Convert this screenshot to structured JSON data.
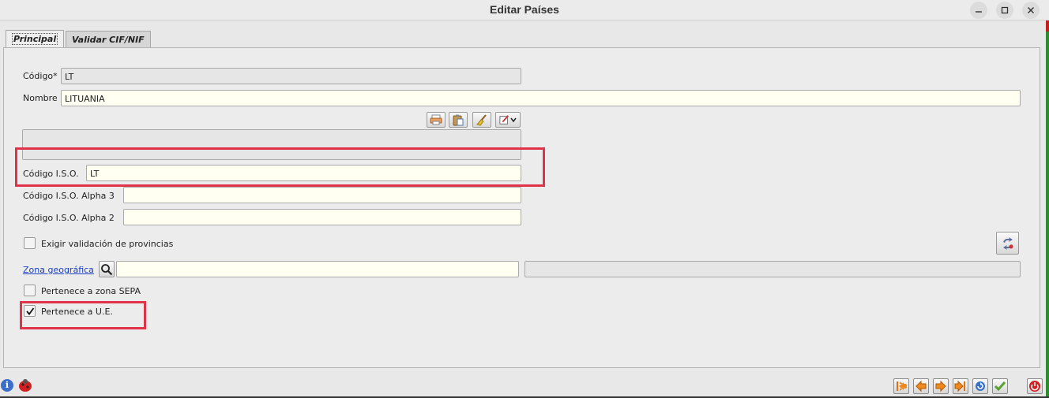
{
  "window": {
    "title": "Editar Países"
  },
  "tabs": [
    {
      "label": "Principal",
      "active": true
    },
    {
      "label": "Validar CIF/NIF",
      "active": false
    }
  ],
  "form": {
    "codigo": {
      "label": "Código*",
      "value": "LT"
    },
    "nombre": {
      "label": "Nombre",
      "value": "LITUANIA"
    },
    "codigo_iso": {
      "label": "Código I.S.O.",
      "value": "LT"
    },
    "codigo_iso_alpha3": {
      "label": "Código I.S.O. Alpha 3",
      "value": ""
    },
    "codigo_iso_alpha2": {
      "label": "Código I.S.O. Alpha 2",
      "value": ""
    },
    "exigir_validacion": {
      "label": "Exigir validación de provincias",
      "checked": false
    },
    "zona_geografica": {
      "label": "Zona geográfica",
      "value": "",
      "description": ""
    },
    "zona_sepa": {
      "label": "Pertenece a zona SEPA",
      "checked": false
    },
    "pertenece_ue": {
      "label": "Pertenece a U.E.",
      "checked": true
    }
  },
  "colors": {
    "highlight": "#e0334a",
    "field_bg": "#fffff2",
    "link": "#1a3fc0"
  }
}
